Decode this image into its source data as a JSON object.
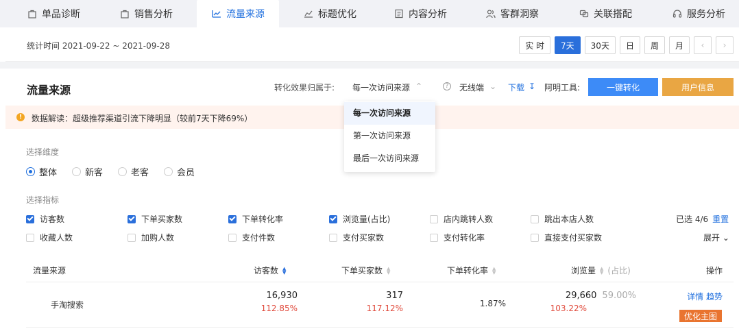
{
  "nav": {
    "items": [
      {
        "label": "单品诊断",
        "icon": "bag-icon"
      },
      {
        "label": "销售分析",
        "icon": "bag-icon"
      },
      {
        "label": "流量来源",
        "icon": "trend-icon",
        "active": true
      },
      {
        "label": "标题优化",
        "icon": "line-chart-icon"
      },
      {
        "label": "内容分析",
        "icon": "document-icon"
      },
      {
        "label": "客群洞察",
        "icon": "users-icon"
      },
      {
        "label": "关联搭配",
        "icon": "link-icon"
      },
      {
        "label": "服务分析",
        "icon": "headset-icon"
      }
    ]
  },
  "timebar": {
    "label": "统计时间 2021-09-22 ~ 2021-09-28",
    "buttons": [
      "实 时",
      "7天",
      "30天",
      "日",
      "周",
      "月"
    ],
    "active": "7天"
  },
  "section": {
    "title": "流量来源",
    "attr_label": "转化效果归属于:",
    "attr_value": "每一次访问来源",
    "device_value": "无线端",
    "download": "下载",
    "tool_label": "阿明工具:",
    "convert_btn": "一键转化",
    "userinfo_btn": "用户信息"
  },
  "alert": {
    "text": "数据解读：超级推荐渠道引流下降明显（较前7天下降69%）"
  },
  "dimension": {
    "title": "选择维度",
    "options": [
      "整体",
      "新客",
      "老客",
      "会员"
    ],
    "selected": "整体"
  },
  "metrics": {
    "title": "选择指标",
    "row1": [
      {
        "label": "访客数",
        "checked": true
      },
      {
        "label": "下单买家数",
        "checked": true
      },
      {
        "label": "下单转化率",
        "checked": true
      },
      {
        "label": "浏览量(占比)",
        "checked": true
      },
      {
        "label": "店内跳转人数",
        "checked": false
      },
      {
        "label": "跳出本店人数",
        "checked": false
      }
    ],
    "row2": [
      {
        "label": "收藏人数",
        "checked": false
      },
      {
        "label": "加购人数",
        "checked": false
      },
      {
        "label": "支付件数",
        "checked": false
      },
      {
        "label": "支付买家数",
        "checked": false
      },
      {
        "label": "支付转化率",
        "checked": false
      },
      {
        "label": "直接支付买家数",
        "checked": false
      }
    ],
    "selected_count": "已选 4/6",
    "reset": "重置",
    "expand": "展开"
  },
  "table": {
    "headers": {
      "source": "流量来源",
      "visitors": "访客数",
      "buyers": "下单买家数",
      "conversion": "下单转化率",
      "pageviews": "浏览量",
      "pageviews_pct": "(占比)",
      "actions": "操作"
    },
    "rows": [
      {
        "source": "手淘搜索",
        "visitors": "16,930",
        "visitors_change": "112.85%",
        "buyers": "317",
        "buyers_change": "117.12%",
        "conversion": "1.87%",
        "pageviews": "29,660",
        "pageviews_share": "59.00%",
        "pageviews_change": "103.22%",
        "link_detail": "详情",
        "link_trend": "趋势",
        "optimize_btn": "优化主图"
      }
    ]
  },
  "dropdown": {
    "items": [
      "每一次访问来源",
      "第一次访问来源",
      "最后一次访问来源"
    ],
    "selected": "每一次访问来源"
  },
  "colors": {
    "primary": "#1f6fde",
    "orange": "#e9a643",
    "red": "#e04a3c",
    "alert_bg": "#fff3ee"
  }
}
